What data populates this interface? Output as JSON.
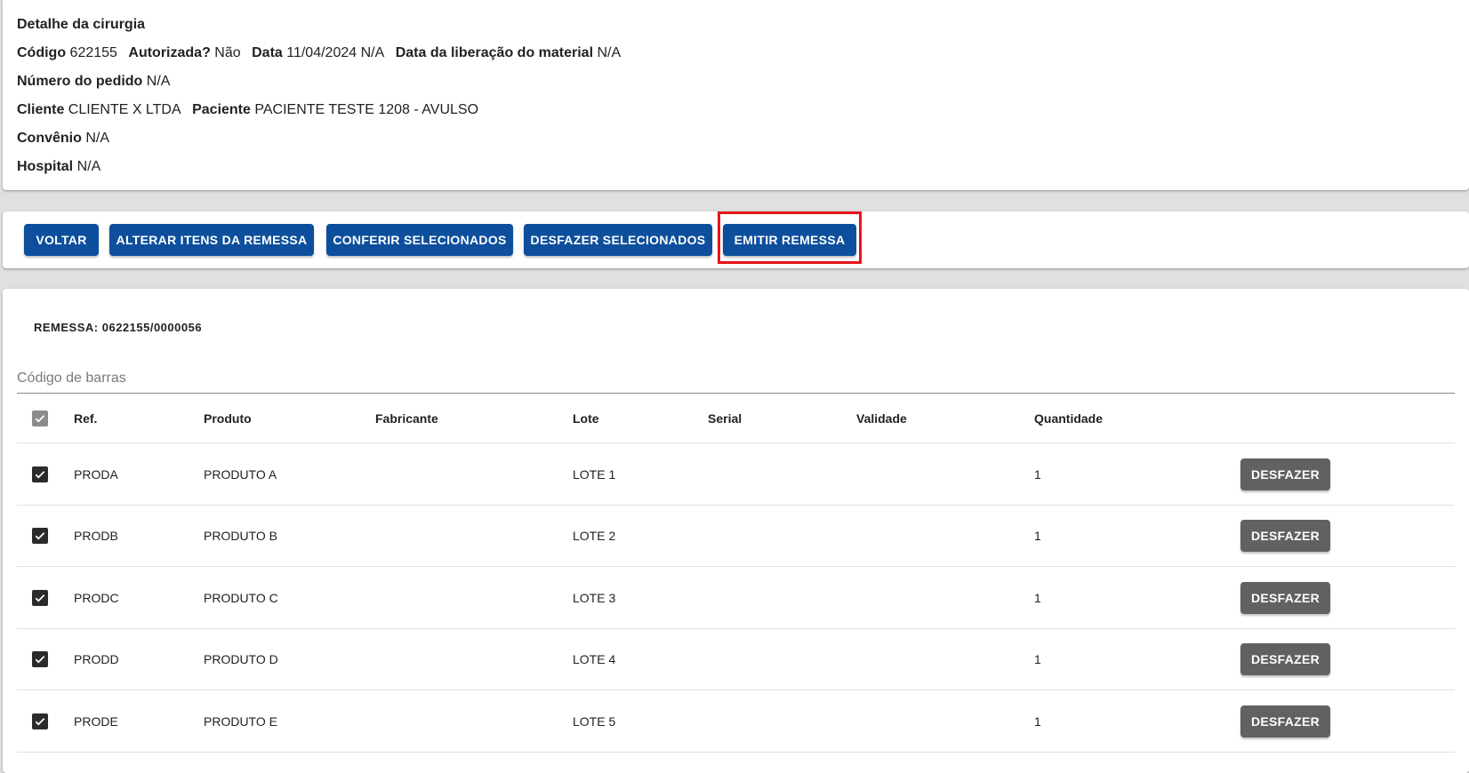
{
  "detail": {
    "title": "Detalhe da cirurgia",
    "codigo_label": "Código",
    "codigo": "622155",
    "autorizada_label": "Autorizada?",
    "autorizada": "Não",
    "data_label": "Data",
    "data": "11/04/2024 N/A",
    "liberacao_label": "Data da liberação do material",
    "liberacao": "N/A",
    "pedido_label": "Número do pedido",
    "pedido": "N/A",
    "cliente_label": "Cliente",
    "cliente": "CLIENTE X LTDA",
    "paciente_label": "Paciente",
    "paciente": "PACIENTE TESTE 1208 - AVULSO",
    "convenio_label": "Convênio",
    "convenio": "N/A",
    "hospital_label": "Hospital",
    "hospital": "N/A"
  },
  "actions": {
    "voltar": "VOLTAR",
    "alterar": "ALTERAR ITENS DA REMESSA",
    "conferir": "CONFERIR SELECIONADOS",
    "desfazer_sel": "DESFAZER SELECIONADOS",
    "emitir": "EMITIR REMESSA"
  },
  "remessa": {
    "title": "REMESSA: 0622155/0000056",
    "barcode_placeholder": "Código de barras",
    "columns": {
      "ref": "Ref.",
      "produto": "Produto",
      "fabricante": "Fabricante",
      "lote": "Lote",
      "serial": "Serial",
      "validade": "Validade",
      "quantidade": "Quantidade"
    },
    "undo_label": "DESFAZER",
    "rows": [
      {
        "ref": "PRODA",
        "produto": "PRODUTO A",
        "fabricante": "",
        "lote": "LOTE 1",
        "serial": "",
        "validade": "",
        "quantidade": "1",
        "checked": true
      },
      {
        "ref": "PRODB",
        "produto": "PRODUTO B",
        "fabricante": "",
        "lote": "LOTE 2",
        "serial": "",
        "validade": "",
        "quantidade": "1",
        "checked": true
      },
      {
        "ref": "PRODC",
        "produto": "PRODUTO C",
        "fabricante": "",
        "lote": "LOTE 3",
        "serial": "",
        "validade": "",
        "quantidade": "1",
        "checked": true
      },
      {
        "ref": "PRODD",
        "produto": "PRODUTO D",
        "fabricante": "",
        "lote": "LOTE 4",
        "serial": "",
        "validade": "",
        "quantidade": "1",
        "checked": true
      },
      {
        "ref": "PRODE",
        "produto": "PRODUTO E",
        "fabricante": "",
        "lote": "LOTE 5",
        "serial": "",
        "validade": "",
        "quantidade": "1",
        "checked": true
      }
    ]
  },
  "colors": {
    "primary_button": "#0d4f9c",
    "secondary_button": "#616161",
    "highlight": "#e8121a"
  }
}
